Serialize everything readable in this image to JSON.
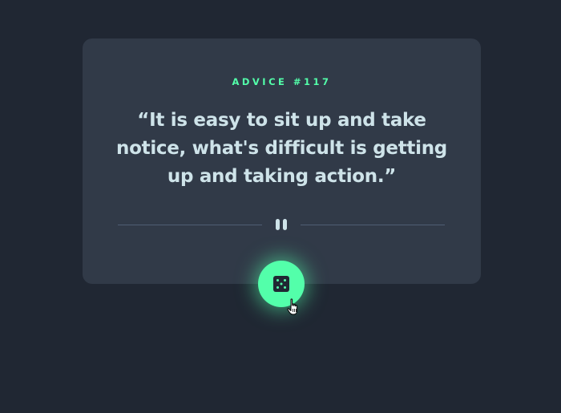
{
  "card": {
    "advice_label": "ADVICE #117",
    "quote": "“It is easy to sit up and take notice, what's difficult is getting up and taking action.”"
  },
  "icons": {
    "divider": "pause-icon",
    "button": "dice-icon",
    "cursor": "hand-pointer-icon"
  },
  "colors": {
    "background": "#202733",
    "card": "#313a48",
    "accent": "#53ffaa",
    "text": "#cee3e9",
    "divider": "#4f5d74"
  }
}
